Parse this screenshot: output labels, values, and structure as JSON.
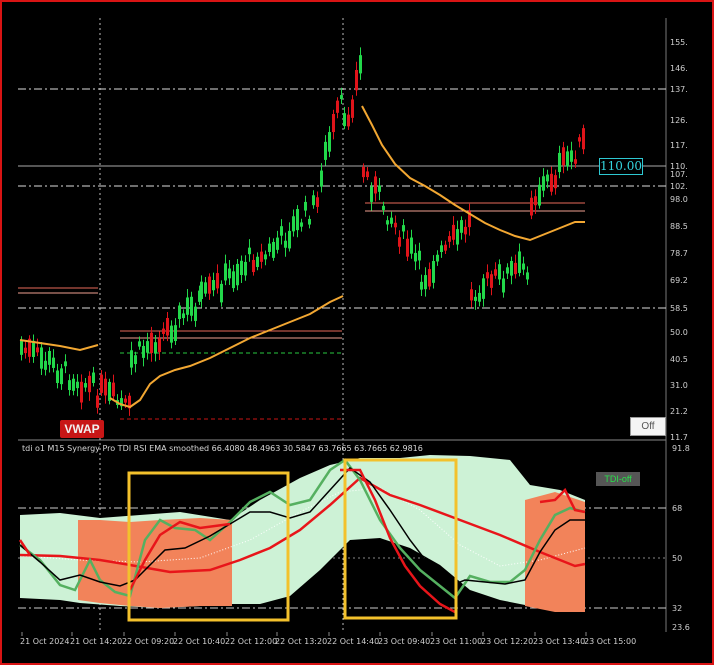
{
  "price_pane": {
    "y_ticks": [
      "155.",
      "146.",
      "137.",
      "126.",
      "117.",
      "110.",
      "107.",
      "102.",
      "98.0",
      "88.5",
      "78.7",
      "69.2",
      "58.5",
      "50.0",
      "40.5",
      "31.0",
      "21.2",
      "11.7"
    ],
    "current_price_label": "110.00",
    "vwap_label": "VWAP",
    "off_button_label": "Off"
  },
  "indicator_pane": {
    "title": "tdi o1 M15 Synergy Pro TDI RSI EMA smoothed 66.4080 48.4963 30.5847 63.7665 63.7665 62.9816",
    "y_ticks": [
      "91.8",
      "68",
      "50",
      "32",
      "23.6"
    ],
    "tdi_button_label": "TDI-off"
  },
  "time_axis": {
    "labels": [
      "21 Oct 2024",
      "21 Oct 14:20",
      "22 Oct 09:20",
      "22 Oct 10:40",
      "22 Oct 12:00",
      "22 Oct 13:20",
      "22 Oct 14:40",
      "23 Oct 09:40",
      "23 Oct 11:00",
      "23 Oct 12:20",
      "23 Oct 13:40",
      "23 Oct 15:00"
    ]
  },
  "colors": {
    "frame": "#d81414",
    "bull": "#22d84a",
    "bear": "#e0141a",
    "vwap_line": "#f2a732",
    "highlight_box": "#f3c12c",
    "band_fill": "#cdf2d6",
    "orange_zone": "#f2835a"
  }
}
